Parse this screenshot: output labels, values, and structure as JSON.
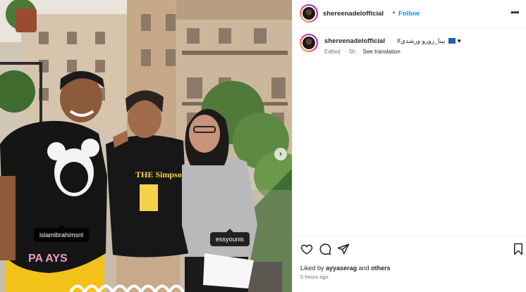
{
  "post": {
    "username": "shereenadelofficial",
    "follow_label": "Follow",
    "more_label": "•••",
    "caption_username": "shereenadelofficial",
    "caption_text": "#بينا_زورو ورشدي",
    "caption_emoji": "♥",
    "edited_label": "Edited",
    "time_short": "5h",
    "see_translation_label": "See translation",
    "liked_by_prefix": "Liked by",
    "liked_by_user": "ayyaserag",
    "liked_by_and": "and",
    "liked_by_others": "others",
    "time_ago": "5 hours ago"
  },
  "photo": {
    "tags": [
      "islamibrahimsnl",
      "essyounis"
    ],
    "shirt_text": "THE Simpsons",
    "next_label": "›"
  },
  "colors": {
    "follow": "#0095f6",
    "text_primary": "#262626",
    "text_secondary": "#737373"
  },
  "icons": [
    "heart-icon",
    "comment-icon",
    "share-icon",
    "bookmark-icon",
    "more-icon",
    "chevron-right-icon"
  ]
}
